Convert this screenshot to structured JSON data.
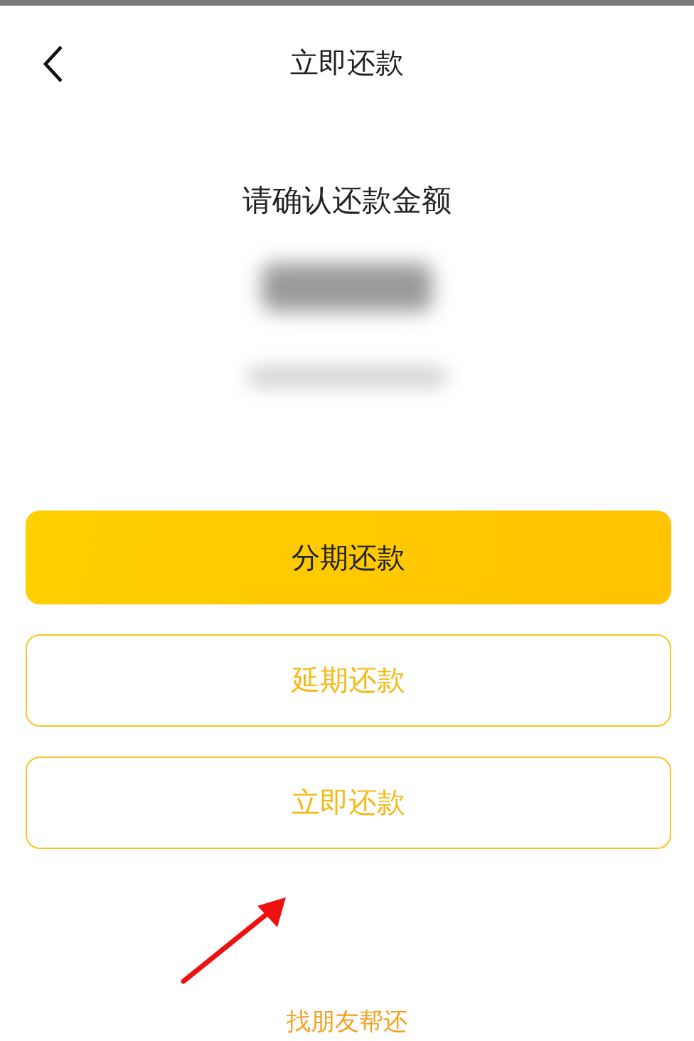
{
  "header": {
    "title": "立即还款"
  },
  "confirm": {
    "prompt": "请确认还款金额"
  },
  "buttons": [
    {
      "label": "分期还款",
      "kind": "filled"
    },
    {
      "label": "延期还款",
      "kind": "outline"
    },
    {
      "label": "立即还款",
      "kind": "outline"
    }
  ],
  "link": {
    "label": "找朋友帮还"
  }
}
